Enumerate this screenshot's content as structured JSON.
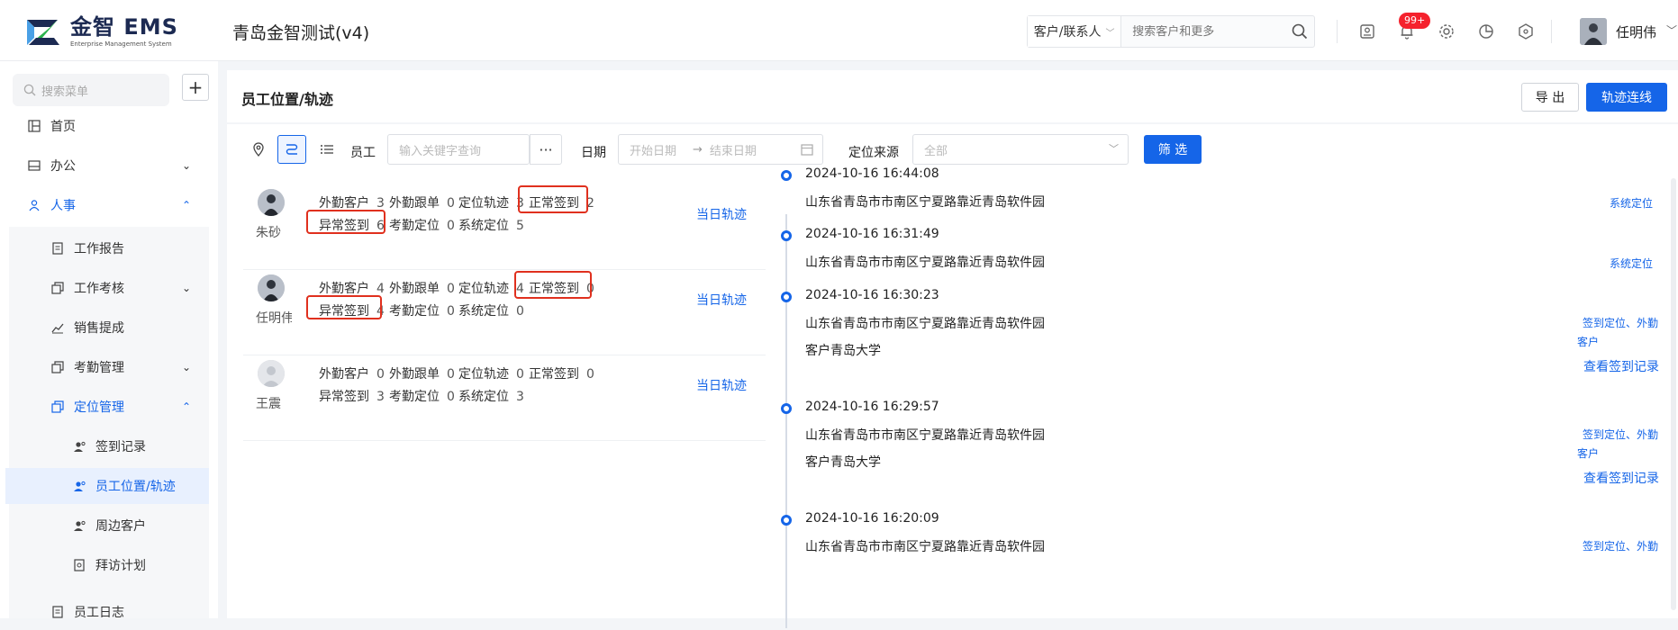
{
  "header": {
    "logo_title": "金智 EMS",
    "logo_sub": "Enterprise Management System",
    "company": "青岛金智测试(v4)",
    "search_type": "客户/联系人",
    "search_placeholder": "搜索客户和更多",
    "badge": "99+",
    "user_name": "任明伟"
  },
  "sidebar": {
    "search_placeholder": "搜索菜单",
    "add_label": "+",
    "items": [
      {
        "label": "首页"
      },
      {
        "label": "办公"
      },
      {
        "label": "人事"
      },
      {
        "label": "工作报告"
      },
      {
        "label": "工作考核"
      },
      {
        "label": "销售提成"
      },
      {
        "label": "考勤管理"
      },
      {
        "label": "定位管理"
      },
      {
        "label": "签到记录"
      },
      {
        "label": "员工位置/轨迹"
      },
      {
        "label": "周边客户"
      },
      {
        "label": "拜访计划"
      },
      {
        "label": "员工日志"
      }
    ]
  },
  "page": {
    "title": "员工位置/轨迹",
    "export_label": "导 出",
    "track_label": "轨迹连线",
    "filter": {
      "employee_label": "员工",
      "employee_placeholder": "输入关键字查询",
      "more": "···",
      "date_label": "日期",
      "start_placeholder": "开始日期",
      "arrow": "→",
      "end_placeholder": "结束日期",
      "source_label": "定位来源",
      "source_value": "全部",
      "filter_button": "筛 选"
    }
  },
  "employees": [
    {
      "name": "朱砂",
      "stats": {
        "外勤客户": "3",
        "外勤跟单": "0",
        "定位轨迹": "3",
        "正常签到": "2",
        "异常签到": "6",
        "考勤定位": "0",
        "系统定位": "5"
      },
      "day_track": "当日轨迹"
    },
    {
      "name": "任明伟",
      "stats": {
        "外勤客户": "4",
        "外勤跟单": "0",
        "定位轨迹": "4",
        "正常签到": "0",
        "异常签到": "4",
        "考勤定位": "0",
        "系统定位": "0"
      },
      "day_track": "当日轨迹"
    },
    {
      "name": "王震",
      "stats": {
        "外勤客户": "0",
        "外勤跟单": "0",
        "定位轨迹": "0",
        "正常签到": "0",
        "异常签到": "3",
        "考勤定位": "0",
        "系统定位": "3"
      },
      "day_track": "当日轨迹"
    }
  ],
  "stat_labels": [
    "外勤客户",
    "外勤跟单",
    "定位轨迹",
    "正常签到",
    "异常签到",
    "考勤定位",
    "系统定位"
  ],
  "timeline": [
    {
      "time": "2024-10-16 16:44:08",
      "address": "山东省青岛市市南区宁夏路靠近青岛软件园",
      "source": "系统定位"
    },
    {
      "time": "2024-10-16 16:31:49",
      "address": "山东省青岛市市南区宁夏路靠近青岛软件园",
      "source": "系统定位"
    },
    {
      "time": "2024-10-16 16:30:23",
      "address": "山东省青岛市市南区宁夏路靠近青岛软件园",
      "customer": "客户青岛大学",
      "source_line1": "签到定位、外勤",
      "source_line2": "客户",
      "link": "查看签到记录"
    },
    {
      "time": "2024-10-16 16:29:57",
      "address": "山东省青岛市市南区宁夏路靠近青岛软件园",
      "customer": "客户青岛大学",
      "source_line1": "签到定位、外勤",
      "source_line2": "客户",
      "link": "查看签到记录"
    },
    {
      "time": "2024-10-16 16:20:09",
      "address": "山东省青岛市市南区宁夏路靠近青岛软件园",
      "source_line1": "签到定位、外勤"
    }
  ],
  "colors": {
    "accent": "#1565e8",
    "highlight": "#e0301e",
    "badge": "#f5222d"
  }
}
